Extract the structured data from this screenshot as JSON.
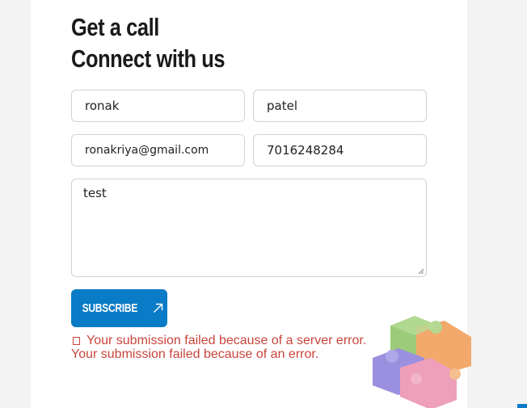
{
  "form": {
    "heading_line1": "Get a call",
    "heading_line2": "Connect with us",
    "first_name": "ronak",
    "last_name": "patel",
    "email": "ronakriya@gmail.com",
    "phone": "7016248284",
    "message": "test",
    "submit_label": "SUBSCRIBE",
    "error_server": "Your submission failed because of a server error.",
    "error_general": "Your submission failed because of an error."
  },
  "colors": {
    "accent": "#0a7bc6",
    "error": "#c9453c"
  },
  "icons": {
    "submit": "arrow-up-right-icon",
    "error": "error-icon",
    "decoration": "puzzle-cube-icon"
  }
}
